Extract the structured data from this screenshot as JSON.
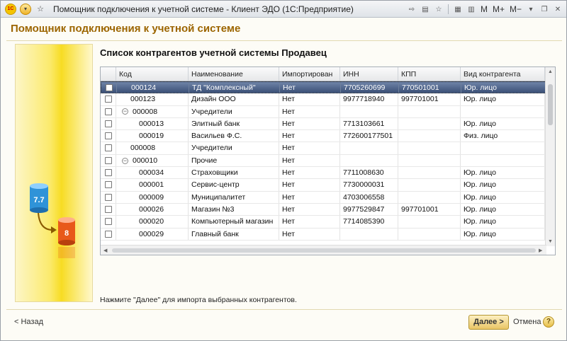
{
  "window": {
    "title": "Помощник подключения к учетной системе - Клиент ЭДО  (1С:Предприятие)"
  },
  "toolbar": {
    "m_label": "M",
    "mplus_label": "M+",
    "mminus_label": "M−"
  },
  "header": {
    "title": "Помощник подключения к учетной системе"
  },
  "main": {
    "subtitle": "Список контрагентов учетной системы Продавец"
  },
  "table": {
    "columns": [
      "Код",
      "Наименование",
      "Импортирован",
      "ИНН",
      "КПП",
      "Вид контрагента"
    ],
    "rows": [
      {
        "code": "000124",
        "name": "ТД \"Комплексный\"",
        "imported": "Нет",
        "inn": "7705260699",
        "kpp": "770501001",
        "kind": "Юр. лицо",
        "selected": true
      },
      {
        "code": "000123",
        "name": "Дизайн ООО",
        "imported": "Нет",
        "inn": "9977718940",
        "kpp": "997701001",
        "kind": "Юр. лицо"
      },
      {
        "code": "000008",
        "name": "Учредители",
        "imported": "Нет",
        "inn": "",
        "kpp": "",
        "kind": "",
        "group": true
      },
      {
        "code": "000013",
        "name": "Элитный банк",
        "imported": "Нет",
        "inn": "7713103661",
        "kpp": "",
        "kind": "Юр. лицо",
        "child": true
      },
      {
        "code": "000019",
        "name": "Васильев Ф.С.",
        "imported": "Нет",
        "inn": "772600177501",
        "kpp": "",
        "kind": "Физ. лицо",
        "child": true
      },
      {
        "code": "000008",
        "name": "Учредители",
        "imported": "Нет",
        "inn": "",
        "kpp": "",
        "kind": ""
      },
      {
        "code": "000010",
        "name": "Прочие",
        "imported": "Нет",
        "inn": "",
        "kpp": "",
        "kind": "",
        "group": true
      },
      {
        "code": "000034",
        "name": "Страховщики",
        "imported": "Нет",
        "inn": "7711008630",
        "kpp": "",
        "kind": "Юр. лицо",
        "child": true
      },
      {
        "code": "000001",
        "name": "Сервис-центр",
        "imported": "Нет",
        "inn": "7730000031",
        "kpp": "",
        "kind": "Юр. лицо",
        "child": true
      },
      {
        "code": "000009",
        "name": "Муниципалитет",
        "imported": "Нет",
        "inn": "4703006558",
        "kpp": "",
        "kind": "Юр. лицо",
        "child": true
      },
      {
        "code": "000026",
        "name": "Магазин №3",
        "imported": "Нет",
        "inn": "9977529847",
        "kpp": "997701001",
        "kind": "Юр. лицо",
        "child": true
      },
      {
        "code": "000020",
        "name": "Компьютерный магазин",
        "imported": "Нет",
        "inn": "7714085390",
        "kpp": "",
        "kind": "Юр. лицо",
        "child": true
      },
      {
        "code": "000029",
        "name": "Главный банк",
        "imported": "Нет",
        "inn": "",
        "kpp": "",
        "kind": "Юр. лицо",
        "child": true
      }
    ]
  },
  "footer": {
    "hint": "Нажмите \"Далее\" для импорта выбранных контрагентов.",
    "back_label": "< Назад",
    "next_label": "Далее >",
    "cancel_label": "Отмена",
    "help_label": "?"
  },
  "illustration": {
    "top_label": "7.7",
    "bottom_label": "8"
  },
  "colors": {
    "accent": "#9c6500",
    "selection": "#3b5077",
    "panel": "#f7dc23"
  }
}
